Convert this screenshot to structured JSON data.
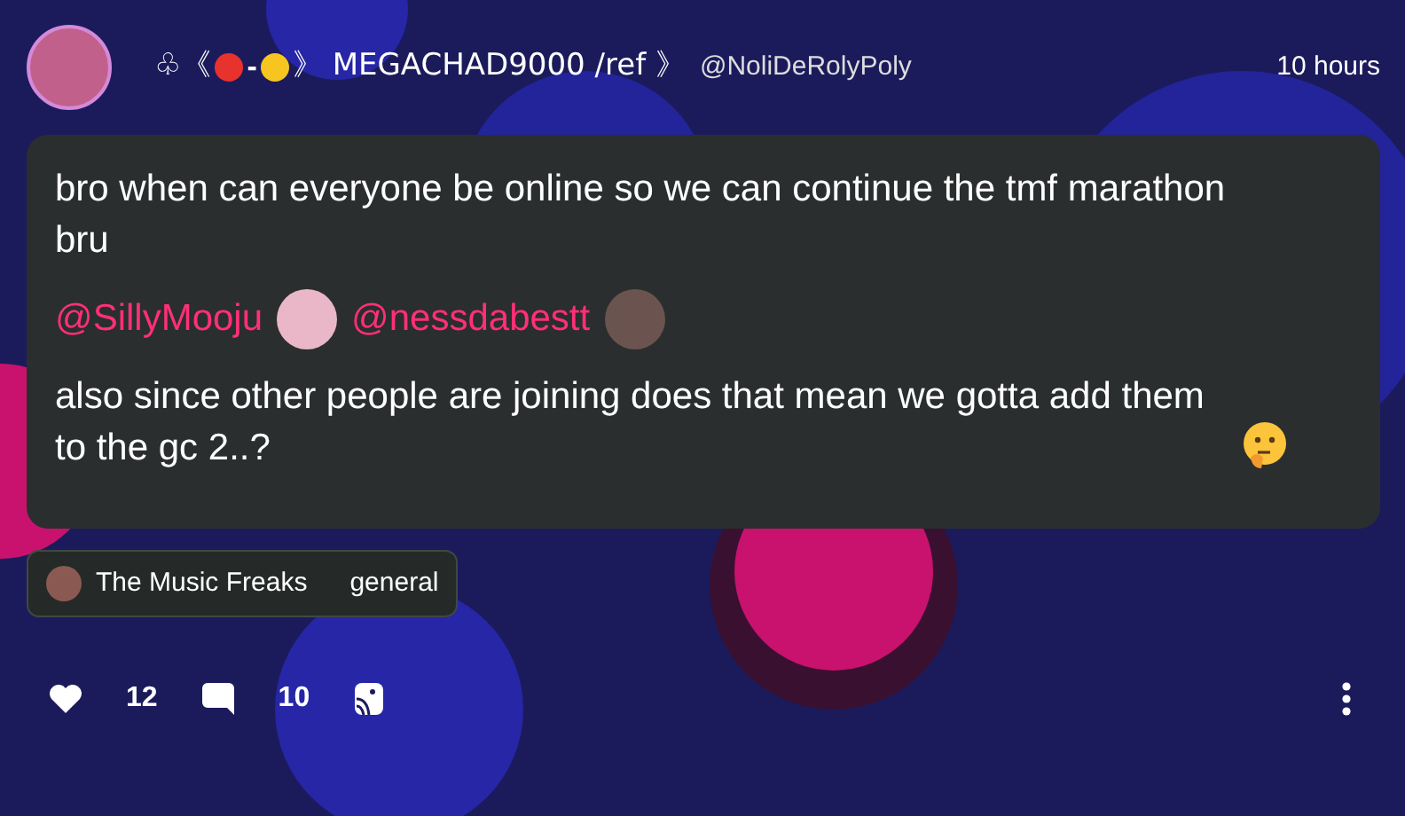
{
  "post": {
    "author": {
      "display_name": [
        {
          "kind": "text",
          "text": "♧《"
        },
        {
          "kind": "dot",
          "color": "#e8322e"
        },
        {
          "kind": "text",
          "text": "-"
        },
        {
          "kind": "dot",
          "color": "#f7c520"
        },
        {
          "kind": "text",
          "text": "》 MEGACHAD9000 /ref 》"
        }
      ],
      "handle": "@NoliDeRolyPoly"
    },
    "time": "10 hours",
    "body": [
      {
        "kind": "text",
        "text": "bro when can everyone be online so we can continue the tmf marathon bru"
      },
      {
        "kind": "mentions",
        "mentions": [
          "@SillyMooju",
          "@nessdabestt"
        ]
      },
      {
        "kind": "text",
        "text": "also since other people are joining does that mean we gotta add them to the gc 2..?",
        "emoji": true
      }
    ],
    "community": {
      "name": "The Music Freaks",
      "channel": "general"
    },
    "likes": "12",
    "comments": "10"
  }
}
